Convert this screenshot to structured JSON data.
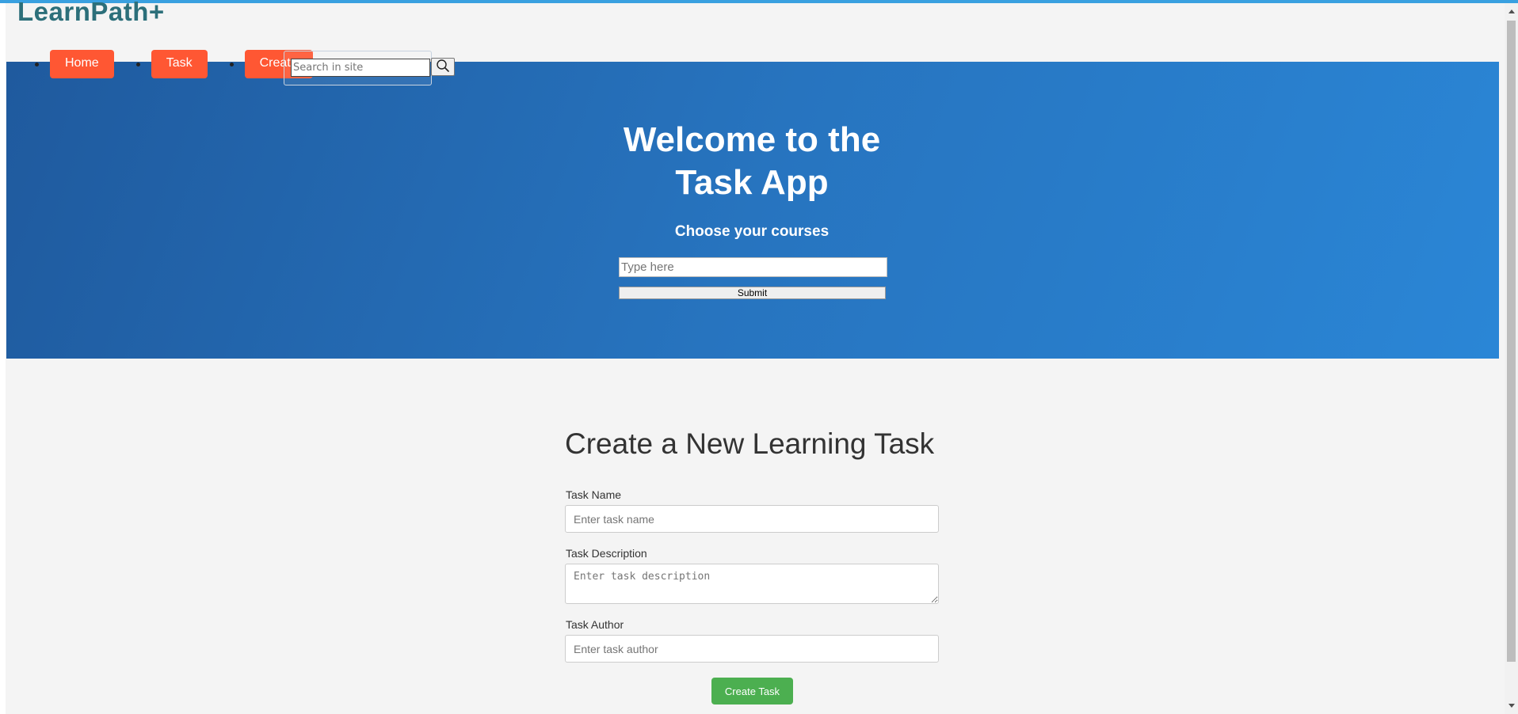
{
  "header": {
    "logo": "LearnPath+"
  },
  "nav": {
    "items": [
      {
        "label": "Home"
      },
      {
        "label": "Task"
      },
      {
        "label": "Create"
      }
    ],
    "search": {
      "placeholder": "Search in site"
    }
  },
  "hero": {
    "title": "Welcome to the Task App",
    "subtitle": "Choose your courses",
    "input_placeholder": "Type here",
    "submit_label": "Submit"
  },
  "form": {
    "title": "Create a New Learning Task",
    "task_name_label": "Task Name",
    "task_name_placeholder": "Enter task name",
    "task_description_label": "Task Description",
    "task_description_placeholder": "Enter task description",
    "task_author_label": "Task Author",
    "task_author_placeholder": "Enter task author",
    "submit_label": "Create Task"
  },
  "colors": {
    "nav_button": "#ff5733",
    "hero_start": "#1f5a9e",
    "hero_end": "#2a86d6",
    "create_button": "#4caf50",
    "logo": "#2c6f7a"
  },
  "icons": {
    "search": "magnifier-icon"
  }
}
